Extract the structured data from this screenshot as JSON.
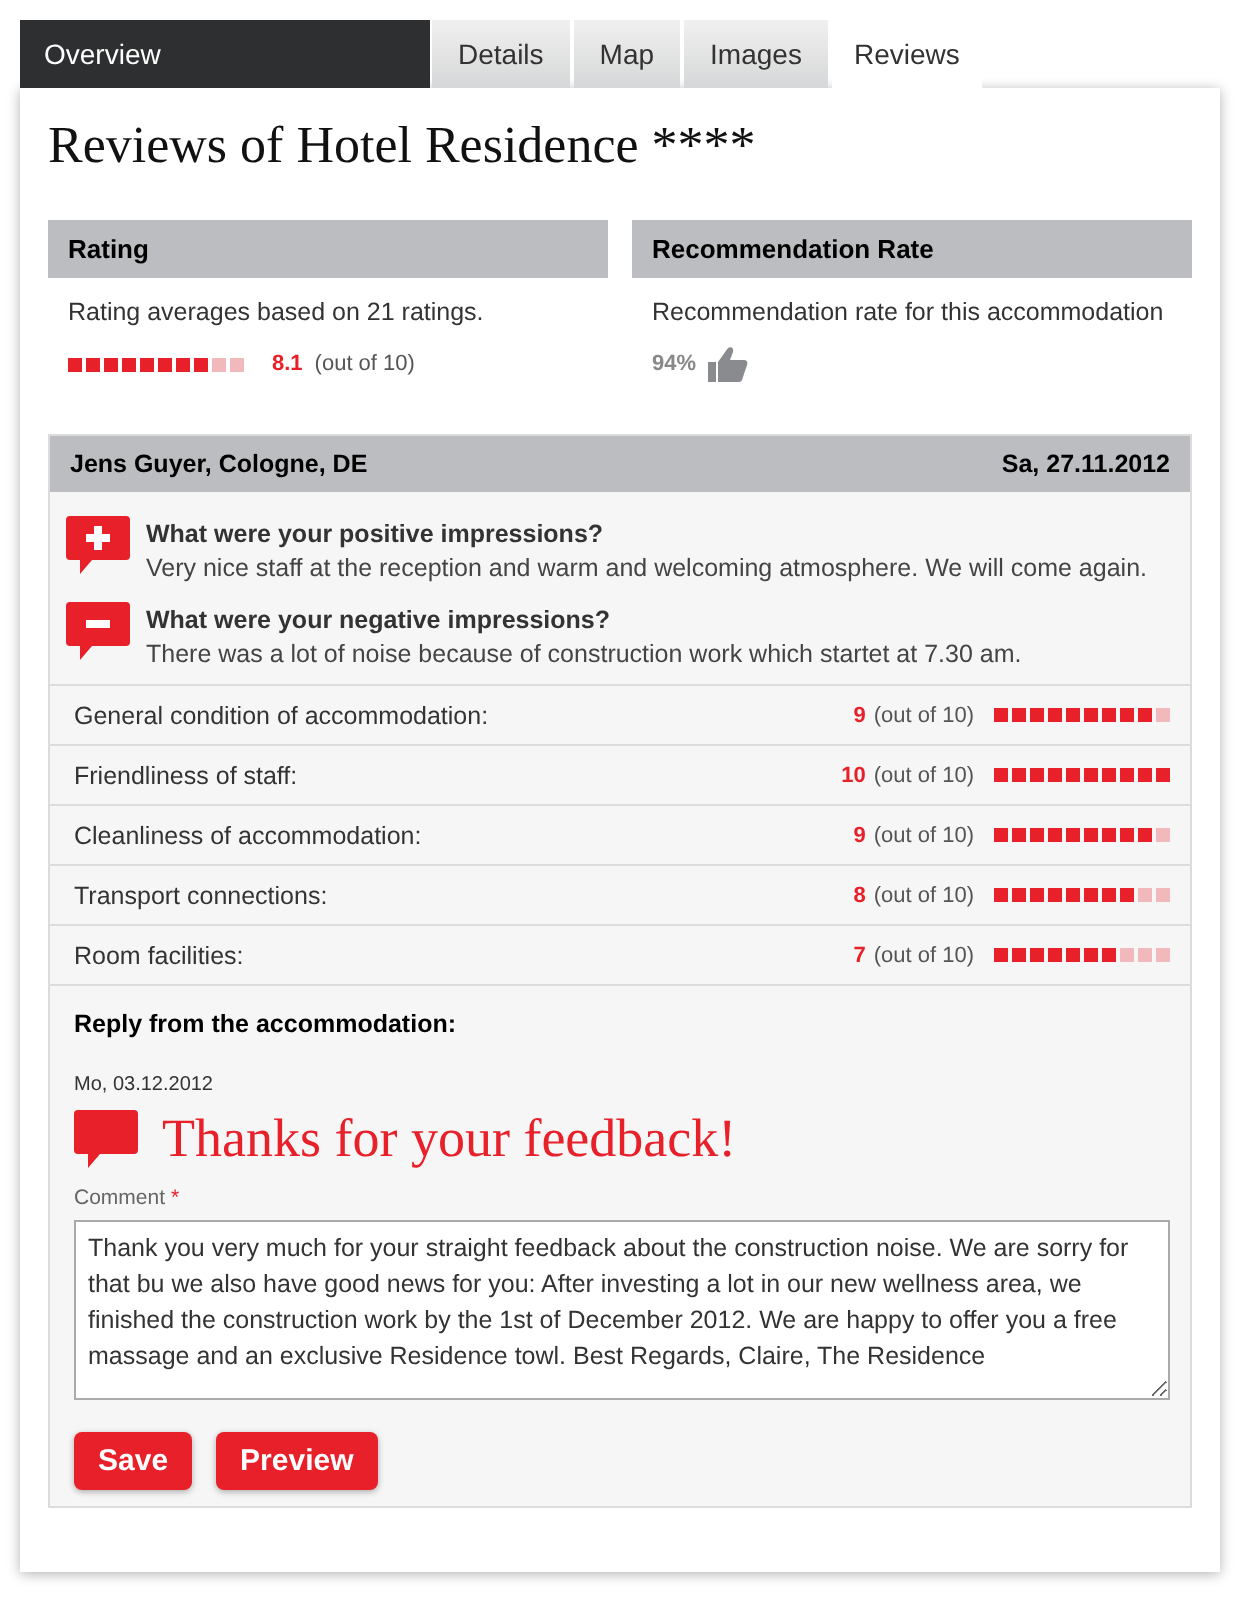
{
  "section_title": "Overview",
  "tabs": [
    {
      "label": "Details",
      "selected": false
    },
    {
      "label": "Map",
      "selected": false
    },
    {
      "label": "Images",
      "selected": false
    },
    {
      "label": "Reviews",
      "selected": true
    }
  ],
  "title": "Reviews of Hotel Residence ****",
  "rating": {
    "heading": "Rating",
    "text": "Rating averages based on 21 ratings.",
    "stars": 8,
    "score": "8.1",
    "out_of": "(out of 10)"
  },
  "recommendation": {
    "heading": "Recommendation Rate",
    "text": "Recommendation rate for this accommodation",
    "percent": "94%"
  },
  "review": {
    "author": "Jens Guyer, Cologne, DE",
    "date": "Sa, 27.11.2012",
    "impressions": [
      {
        "kind": "positive",
        "question": "What were your positive impressions?",
        "answer": "Very nice staff at the reception and warm and welcoming atmosphere. We will come again."
      },
      {
        "kind": "negative",
        "question": "What were your negative impressions?",
        "answer": "There was a lot of noise because of construction work which startet at 7.30 am."
      }
    ],
    "criteria": [
      {
        "label": "General condition of accommodation:",
        "score": "9",
        "out_of": "(out of 10)",
        "stars": 9
      },
      {
        "label": "Friendliness of staff:",
        "score": "10",
        "out_of": "(out of 10)",
        "stars": 10
      },
      {
        "label": "Cleanliness of accommodation:",
        "score": "9",
        "out_of": "(out of 10)",
        "stars": 9
      },
      {
        "label": "Transport connections:",
        "score": "8",
        "out_of": "(out of 10)",
        "stars": 8
      },
      {
        "label": "Room facilities:",
        "score": "7",
        "out_of": "(out of 10)",
        "stars": 7
      }
    ]
  },
  "reply": {
    "heading": "Reply from the accommodation:",
    "date": "Mo, 03.12.2012",
    "headline": "Thanks for your feedback!",
    "comment_label": "Comment",
    "required_mark": "*",
    "comment": "Thank you very much for your straight feedback about the construction noise. We are sorry for that bu we also have good news for you: After investing a lot in our new wellness area, we finished the construction work by the 1st of December 2012. We are happy to offer you a free massage and an exclusive Residence towl. Best Regards, Claire, The Residence"
  },
  "buttons": [
    "Save",
    "Preview"
  ]
}
